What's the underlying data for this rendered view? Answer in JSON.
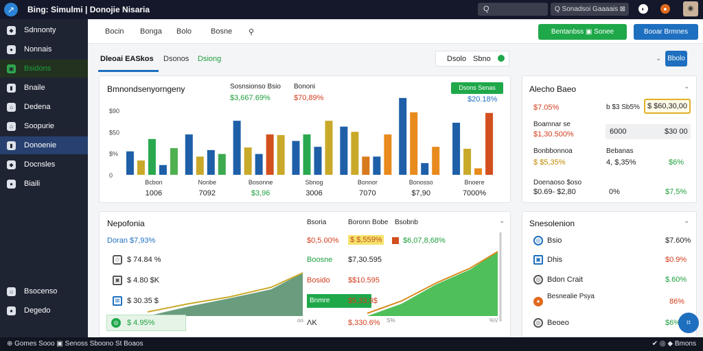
{
  "topbar": {
    "logo": "↗",
    "title": "Bing: Simulmi | Donojie Nisaria",
    "search1": "Q",
    "search2": "Q  Sonadsoi Gaaaais",
    "search2_icon": "⊠",
    "icons": [
      "◐",
      "●"
    ],
    "avatar": "◉"
  },
  "sidebar": {
    "items": [
      {
        "label": "Sdnnonty",
        "icon": "◆"
      },
      {
        "label": "Nonnais",
        "icon": "●"
      },
      {
        "label": "Bsidons",
        "icon": "▣"
      },
      {
        "label": "Bnaile",
        "icon": "▮"
      },
      {
        "label": "Dedena",
        "icon": "⌂"
      },
      {
        "label": "Soopurie",
        "icon": "⌂"
      },
      {
        "label": "Donoenie",
        "icon": "▮"
      },
      {
        "label": "Docnsles",
        "icon": "◆"
      },
      {
        "label": "Biaili",
        "icon": "●"
      }
    ],
    "footer": [
      {
        "label": "Bsocenso",
        "icon": "⌂"
      },
      {
        "label": "Degedo",
        "icon": "●"
      }
    ]
  },
  "toptabs": {
    "tabs": [
      "Bocin",
      "Bonga",
      "Bolo",
      "Bosne"
    ],
    "search_icon": "⚲",
    "btn_green": "Bentanbss  ▣ Sonee",
    "btn_blue": "Booar Brmnes"
  },
  "subtabs": {
    "active": "Dleoai EASkos",
    "tab2": "Dsonos",
    "tab3": "Dsiong",
    "pill1": "Dsolo",
    "pill2": "Sbno",
    "sbtn": "Bbolo"
  },
  "chart_card": {
    "title": "Bmnondsenyorngeny",
    "col1": "Sosnsionso  Bsio",
    "col1v": "$3,667.69%",
    "col2": "Bononi",
    "col2v": "$70,89%",
    "badge": "Dsons Senas",
    "badgev": "$20.18%",
    "chart_data": {
      "type": "bar",
      "yticks": [
        "$90",
        "$50",
        "$%",
        "0"
      ],
      "ylim": [
        0,
        100
      ],
      "groups": [
        {
          "label": "Bcbon",
          "value": "1006",
          "bars": [
            {
              "v": 36,
              "c": "#1e5fa8"
            },
            {
              "v": 22,
              "c": "#c9a92a"
            },
            {
              "v": 55,
              "c": "#2aa84f"
            },
            {
              "v": 15,
              "c": "#1e5fa8"
            },
            {
              "v": 41,
              "c": "#4fb04f"
            }
          ]
        },
        {
          "label": "Nonbe",
          "value": "7092",
          "bars": [
            {
              "v": 62,
              "c": "#1e5fa8"
            },
            {
              "v": 28,
              "c": "#c9a92a"
            },
            {
              "v": 38,
              "c": "#1e5fa8"
            },
            {
              "v": 32,
              "c": "#3daa4f"
            }
          ]
        },
        {
          "label": "Bosonne",
          "value": "$3,96",
          "bars": [
            {
              "v": 83,
              "c": "#1e5fa8"
            },
            {
              "v": 42,
              "c": "#c9a92a"
            },
            {
              "v": 32,
              "c": "#1e5fa8"
            },
            {
              "v": 62,
              "c": "#d24f1e"
            },
            {
              "v": 61,
              "c": "#c9a92a"
            }
          ]
        },
        {
          "label": "Sbnog",
          "value": "3006",
          "bars": [
            {
              "v": 52,
              "c": "#1e5fa8"
            },
            {
              "v": 62,
              "c": "#2aa84f"
            },
            {
              "v": 43,
              "c": "#1e5fa8"
            },
            {
              "v": 83,
              "c": "#c9a92a"
            }
          ]
        },
        {
          "label": "Bonnor",
          "value": "7070",
          "bars": [
            {
              "v": 74,
              "c": "#1e5fa8"
            },
            {
              "v": 66,
              "c": "#c9a92a"
            },
            {
              "v": 28,
              "c": "#d87a1e"
            },
            {
              "v": 28,
              "c": "#1e5fa8"
            },
            {
              "v": 62,
              "c": "#e88a1e"
            }
          ]
        },
        {
          "label": "Bonosso",
          "value": "$7,90",
          "bars": [
            {
              "v": 118,
              "c": "#1e5fa8"
            },
            {
              "v": 96,
              "c": "#e88a1e"
            },
            {
              "v": 18,
              "c": "#1e5fa8"
            },
            {
              "v": 43,
              "c": "#e88a1e"
            }
          ]
        },
        {
          "label": "Bnoere",
          "value": "7000%",
          "bars": [
            {
              "v": 80,
              "c": "#1e5fa8"
            },
            {
              "v": 40,
              "c": "#c9a92a"
            },
            {
              "v": 10,
              "c": "#e88a1e"
            },
            {
              "v": 95,
              "c": "#d24f1e"
            }
          ]
        }
      ]
    }
  },
  "alert_card": {
    "title": "Alecho Baeo",
    "rows": [
      {
        "a": "$7.05%",
        "b": "b $3 Sb5%",
        "c": "$ $60,30,00"
      },
      {
        "a": "Boamnar se",
        "a2": "$1,30.500%",
        "b": "6000",
        "c": "$30 00"
      },
      {
        "a": "Bonbbonnoa",
        "a2": "$ $5,35%",
        "b": "Bebanas",
        "b2": "4, $,35%",
        "c": "$6%"
      },
      {
        "a": "Doenaoso $oso",
        "a2": "$0.69- $2,80",
        "b": "0%",
        "c": "$7,5%"
      }
    ]
  },
  "nep_card": {
    "title": "Nepofonia",
    "h1": "Bsoria",
    "h2": "Boronn Bobe",
    "h3": "Bsobnb",
    "rows": [
      {
        "label": "Doran $7,93%",
        "icon": "",
        "c2": "$0,5.00%",
        "c3": "$ $,559%",
        "c4": "$6,07,8,68%"
      },
      {
        "label": "$ 74.84 %",
        "icon": "◇",
        "c2": "Boosne",
        "c3": "$7,30.595"
      },
      {
        "label": "$ 4.80 $K",
        "icon": "▣",
        "c2": "Bosido",
        "c3": "$$10.595"
      },
      {
        "label": "$ 30.35 $",
        "icon": "⊠",
        "c2": "Bnmre",
        "c3": "$5,33,9$"
      },
      {
        "label": "$ 4.95%",
        "icon": "◎",
        "c2": "ΛΚ",
        "c3": "$,330.6%"
      }
    ],
    "axis_l": "oo",
    "axis_r": "%V",
    "axis_m": "S%"
  },
  "sess_card": {
    "title": "Snesolenion",
    "rows": [
      {
        "icon": "◎",
        "label": "Bsio",
        "value": "$7.60%"
      },
      {
        "icon": "▣",
        "label": "Dhis",
        "value": "$0.9%"
      },
      {
        "icon": "◎",
        "label": "Bdon Crait",
        "value": "$.60%"
      },
      {
        "icon": "●",
        "label": "Besnealie Psya",
        "value": "86%"
      },
      {
        "icon": "◎",
        "label": "Beoeo",
        "value": "$6%"
      }
    ]
  },
  "fab": "⌗",
  "bottom": {
    "left": "⊕   Gomes Sooo   ▣   Senoss Sboono St Boaos",
    "right": "✔   ◎   ◆   Bmons"
  }
}
